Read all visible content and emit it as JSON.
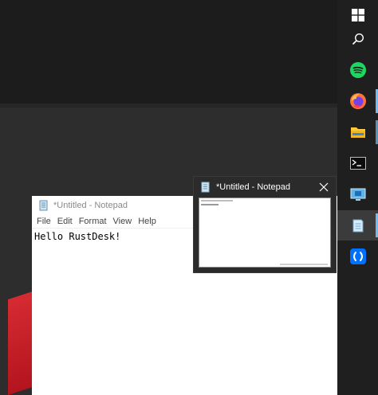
{
  "notepad": {
    "title": "*Untitled - Notepad",
    "menu": [
      "File",
      "Edit",
      "Format",
      "View",
      "Help"
    ],
    "content": "Hello RustDesk!"
  },
  "thumbnail": {
    "title": "*Untitled - Notepad"
  },
  "taskbar": {
    "items": [
      {
        "name": "start-button",
        "icon": "windows-logo-icon"
      },
      {
        "name": "search-button",
        "icon": "search-icon"
      },
      {
        "name": "spotify-button",
        "icon": "spotify-icon"
      },
      {
        "name": "firefox-button",
        "icon": "firefox-icon"
      },
      {
        "name": "file-explorer-button",
        "icon": "folder-icon"
      },
      {
        "name": "terminal-button",
        "icon": "terminal-icon"
      },
      {
        "name": "remote-desktop-button",
        "icon": "remote-desktop-icon"
      },
      {
        "name": "notepad-button",
        "icon": "notepad-icon"
      },
      {
        "name": "rustdesk-button",
        "icon": "rustdesk-icon"
      }
    ],
    "accent": "#76b9ed"
  }
}
